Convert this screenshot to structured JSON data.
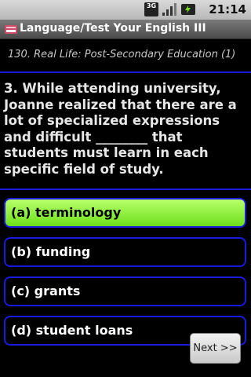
{
  "status_bar": {
    "network": "3G",
    "time": "21:14"
  },
  "title_bar": {
    "title": "Language/Test Your English III"
  },
  "lesson": {
    "subtitle": "130. Real Life: Post-Secondary Education (1)"
  },
  "question": {
    "text": "3. While attending university, Joanne realized that there are a lot of specialized expressions and difficult ________ that students must learn in each specific field of study."
  },
  "answers": [
    {
      "label": "(a) terminology",
      "selected": true
    },
    {
      "label": "(b) funding",
      "selected": false
    },
    {
      "label": "(c) grants",
      "selected": false
    },
    {
      "label": "(d) student loans",
      "selected": false
    }
  ],
  "navigation": {
    "next_label": "Next >>"
  },
  "colors": {
    "accent_border": "#1a1add",
    "selected_fill": "#8aeb2a",
    "background": "#000000"
  }
}
